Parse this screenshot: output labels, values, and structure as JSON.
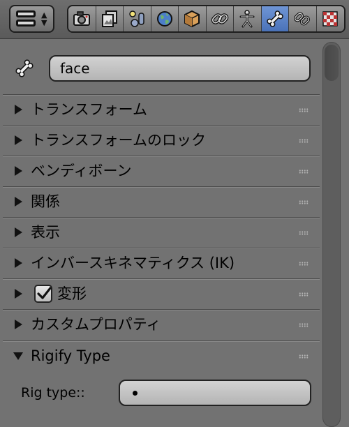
{
  "header": {
    "editor_type_icon": "properties-editor-icon",
    "context_tabs": [
      {
        "name": "render",
        "icon": "camera-icon",
        "active": false
      },
      {
        "name": "render-layers",
        "icon": "layers-icon",
        "active": false
      },
      {
        "name": "scene",
        "icon": "scene-icon",
        "active": false
      },
      {
        "name": "world",
        "icon": "globe-icon",
        "active": false
      },
      {
        "name": "object",
        "icon": "cube-icon",
        "active": false
      },
      {
        "name": "constraints",
        "icon": "chain-icon",
        "active": false
      },
      {
        "name": "armature",
        "icon": "stick-figure-icon",
        "active": false
      },
      {
        "name": "bone",
        "icon": "bone-icon",
        "active": true
      },
      {
        "name": "bone-constraints",
        "icon": "bone-constraint-icon",
        "active": false
      },
      {
        "name": "texture",
        "icon": "checker-icon",
        "active": false
      }
    ],
    "active_color": "#5680c2"
  },
  "bone_name": {
    "icon": "bone-icon",
    "value": "face"
  },
  "sections": [
    {
      "label": "トランスフォーム",
      "expanded": false
    },
    {
      "label": "トランスフォームのロック",
      "expanded": false
    },
    {
      "label": "ベンディボーン",
      "expanded": false
    },
    {
      "label": "関係",
      "expanded": false
    },
    {
      "label": "表示",
      "expanded": false
    },
    {
      "label": "インバースキネマティクス (IK)",
      "expanded": false
    },
    {
      "label": "変形",
      "expanded": false,
      "checkbox": true,
      "checked": true
    },
    {
      "label": "カスタムプロパティ",
      "expanded": false
    },
    {
      "label": "Rigify Type",
      "expanded": true
    }
  ],
  "rigify": {
    "rig_type_label": "Rig type::",
    "rig_type_value": ""
  }
}
